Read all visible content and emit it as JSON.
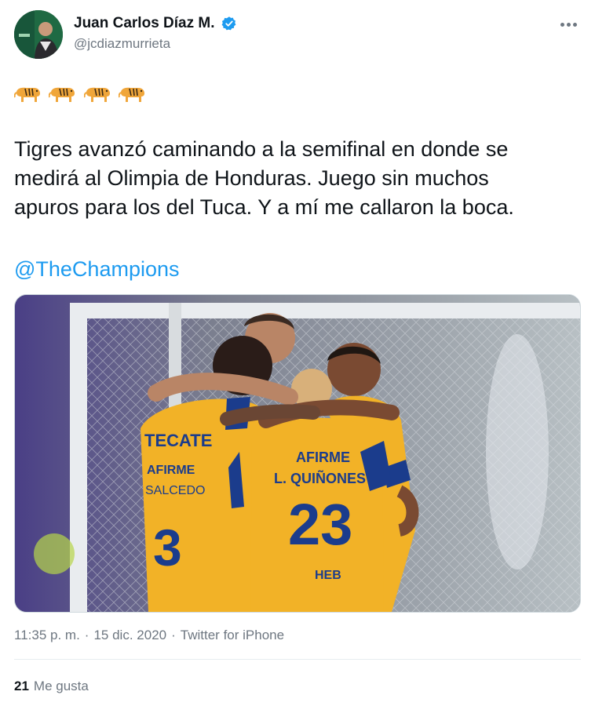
{
  "author": {
    "display_name": "Juan Carlos Díaz M.",
    "handle": "@jcdiazmurrieta",
    "verified": true
  },
  "icons": {
    "more": "more-options-icon",
    "verified": "verified-badge-icon",
    "emoji": "tiger-emoji"
  },
  "tweet": {
    "emoji_count": 4,
    "text": "Tigres avanzó caminando a la semifinal en donde se\nmedirá al Olimpia de Honduras. Juego sin muchos\napuros para los del Tuca. Y a mí me callaron la boca.",
    "mention": "@TheChampions"
  },
  "media": {
    "jersey_text_left": [
      "TECATE",
      "AFIRME",
      "SALCEDO",
      "3"
    ],
    "jersey_text_center": [
      "AFIRME",
      "L. QUIÑONES",
      "23",
      "HEB"
    ]
  },
  "meta": {
    "time": "11:35 p. m.",
    "date": "15 dic. 2020",
    "separator": "·",
    "source": "Twitter for iPhone"
  },
  "likes": {
    "count": "21",
    "label": "Me gusta"
  },
  "colors": {
    "link": "#1d9bf0",
    "verified": "#1d9bf0",
    "muted": "#6e7781",
    "jersey": "#f2b227",
    "jersey_stripe": "#1b3c8c"
  }
}
